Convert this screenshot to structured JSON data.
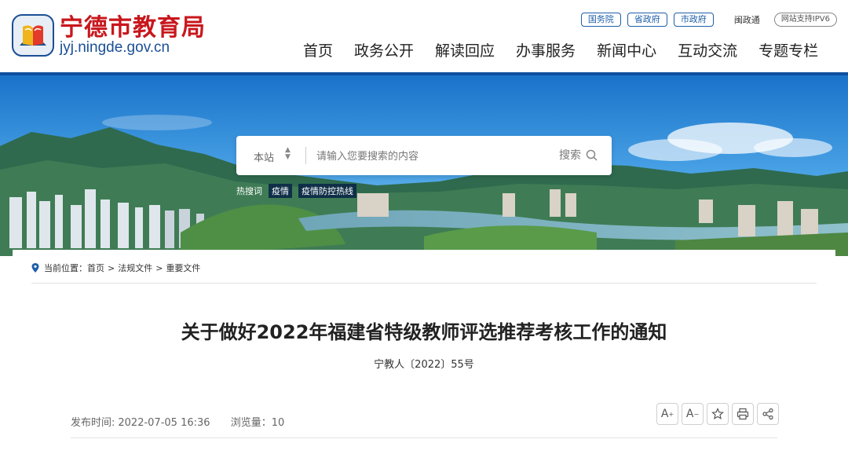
{
  "header": {
    "site_name": "宁德市教育局",
    "domain": "jyj.ningde.gov.cn",
    "top_links": [
      "国务院",
      "省政府",
      "市政府"
    ],
    "min_zheng_tong": "闽政通",
    "ipv6_badge": "网站支持IPV6"
  },
  "nav": {
    "items": [
      "首页",
      "政务公开",
      "解读回应",
      "办事服务",
      "新闻中心",
      "互动交流",
      "专题专栏"
    ]
  },
  "search": {
    "scope": "本站",
    "placeholder": "请输入您要搜索的内容",
    "button_label": "搜索"
  },
  "hot_search": {
    "label": "热搜词",
    "tags": [
      "疫情",
      "疫情防控热线"
    ]
  },
  "breadcrumb": {
    "prefix": "当前位置：",
    "items": [
      "首页",
      "法规文件",
      "重要文件"
    ],
    "separator": ">"
  },
  "article": {
    "title": "关于做好2022年福建省特级教师评选推荐考核工作的通知",
    "doc_number": "宁教人〔2022〕55号",
    "publish_label": "发布时间:",
    "publish_time": "2022-07-05 16:36",
    "views_label": "浏览量：",
    "views": "10"
  },
  "tools": {
    "font_up": "A",
    "font_down": "A"
  },
  "colors": {
    "brand_red": "#c8171d",
    "brand_blue": "#0f4fa0",
    "link_blue": "#1d5fa8"
  }
}
